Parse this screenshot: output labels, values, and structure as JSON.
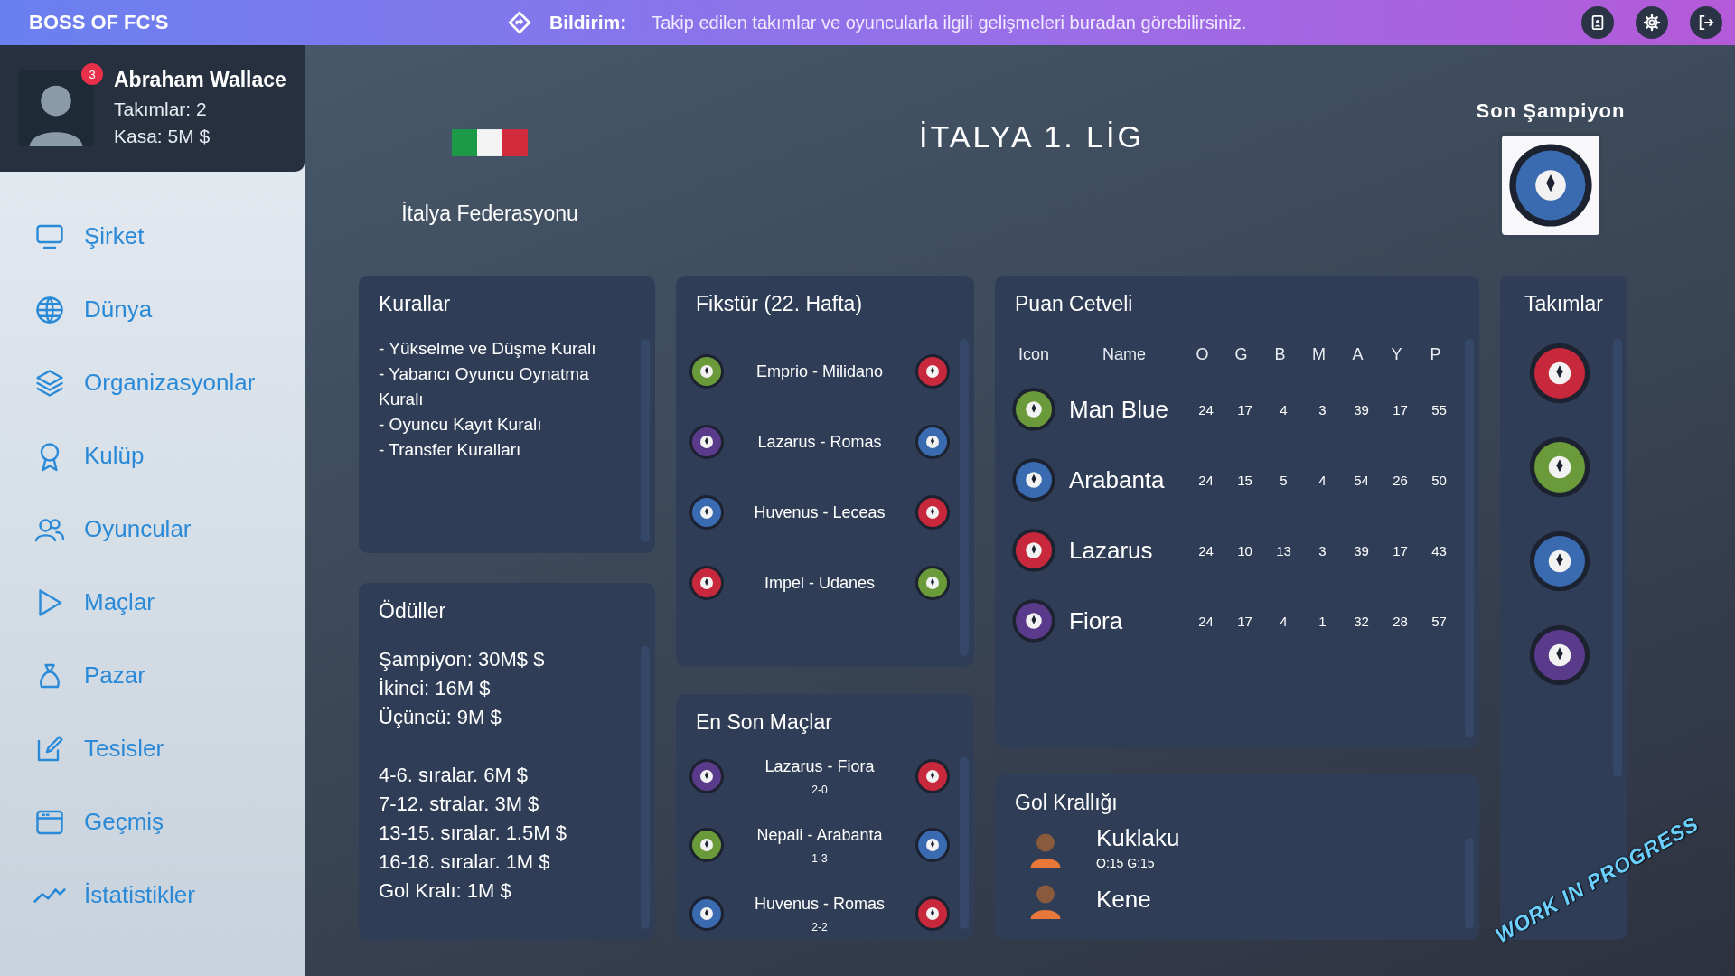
{
  "top_bar": {
    "app_title": "BOSS OF FC'S",
    "notice_label": "Bildirim:",
    "notice_text": "Takip edilen takımlar ve oyuncularla ilgili gelişmeleri buradan görebilirsiniz."
  },
  "profile": {
    "badge": "3",
    "name": "Abraham Wallace",
    "teams": "Takımlar: 2",
    "cash": "Kasa: 5M $"
  },
  "sidebar": {
    "items": [
      {
        "label": "Şirket",
        "kind": "monitor"
      },
      {
        "label": "Dünya",
        "kind": "globe"
      },
      {
        "label": "Organizasyonlar",
        "kind": "layers"
      },
      {
        "label": "Kulüp",
        "kind": "award"
      },
      {
        "label": "Oyuncular",
        "kind": "users"
      },
      {
        "label": "Maçlar",
        "kind": "play"
      },
      {
        "label": "Pazar",
        "kind": "bag"
      },
      {
        "label": "Tesisler",
        "kind": "edit"
      },
      {
        "label": "Geçmiş",
        "kind": "calendar"
      },
      {
        "label": "İstatistikler",
        "kind": "trend"
      }
    ]
  },
  "league": {
    "federation": "İtalya Federasyonu",
    "title": "İTALYA 1. LİG",
    "champion_label": "Son Şampiyon",
    "champion": {
      "color": "#3a6ab0"
    }
  },
  "rules": {
    "title": "Kurallar",
    "lines": [
      "- Yükselme ve Düşme Kuralı",
      "- Yabancı Oyuncu Oynatma Kuralı",
      "- Oyuncu Kayıt Kuralı",
      "- Transfer Kuralları"
    ]
  },
  "prizes": {
    "title": "Ödüller",
    "groups": [
      [
        "Şampiyon: 30M$ $",
        "İkinci: 16M $",
        "Üçüncü: 9M $"
      ],
      [
        "4-6. sıralar. 6M $",
        "7-12. stralar. 3M $",
        "13-15. sıralar. 1.5M $",
        "16-18. sıralar. 1M $",
        "Gol Kralı: 1M $"
      ]
    ]
  },
  "fixtures": {
    "title": "Fikstür (22. Hafta)",
    "matches": [
      {
        "home": {
          "color": "#6a9a3a"
        },
        "match": "Emprio - Milidano",
        "away": {
          "color": "#c8283c"
        }
      },
      {
        "home": {
          "color": "#5a3a8a"
        },
        "match": "Lazarus - Romas",
        "away": {
          "color": "#3a6ab0"
        }
      },
      {
        "home": {
          "color": "#3a6ab0"
        },
        "match": "Huvenus - Leceas",
        "away": {
          "color": "#c8283c"
        }
      },
      {
        "home": {
          "color": "#c8283c"
        },
        "match": "Impel - Udanes",
        "away": {
          "color": "#6a9a3a"
        }
      }
    ]
  },
  "recent": {
    "title": "En Son Maçlar",
    "matches": [
      {
        "home": {
          "color": "#5a3a8a"
        },
        "match": "Lazarus - Fiora",
        "score": "2-0",
        "away": {
          "color": "#c8283c"
        }
      },
      {
        "home": {
          "color": "#6a9a3a"
        },
        "match": "Nepali - Arabanta",
        "score": "1-3",
        "away": {
          "color": "#3a6ab0"
        }
      },
      {
        "home": {
          "color": "#3a6ab0"
        },
        "match": "Huvenus - Romas",
        "score": "2-2",
        "away": {
          "color": "#c8283c"
        }
      }
    ]
  },
  "standings": {
    "title": "Puan Cetveli",
    "columns": [
      "Icon",
      "Name",
      "O",
      "G",
      "B",
      "M",
      "A",
      "Y",
      "P"
    ],
    "rows": [
      {
        "color": "#6a9a3a",
        "cells": [
          "",
          "Man Blue",
          "24",
          "17",
          "4",
          "3",
          "39",
          "17",
          "55"
        ]
      },
      {
        "color": "#3a6ab0",
        "cells": [
          "",
          "Arabanta",
          "24",
          "15",
          "5",
          "4",
          "54",
          "26",
          "50"
        ]
      },
      {
        "color": "#c8283c",
        "cells": [
          "",
          "Lazarus",
          "24",
          "10",
          "13",
          "3",
          "39",
          "17",
          "43"
        ]
      },
      {
        "color": "#5a3a8a",
        "cells": [
          "",
          "Fiora",
          "24",
          "17",
          "4",
          "1",
          "32",
          "28",
          "57"
        ]
      }
    ]
  },
  "top_scorers": {
    "title": "Gol Krallığı",
    "players": [
      {
        "name": "Kuklaku",
        "stats": "O:15  G:15"
      },
      {
        "name": "Kene"
      }
    ]
  },
  "teams": {
    "title": "Takımlar",
    "items": [
      {
        "color": "#c8283c"
      },
      {
        "color": "#6a9a3a"
      },
      {
        "color": "#3a6ab0"
      },
      {
        "color": "#5a3a8a"
      }
    ]
  },
  "stamp": "WORK IN PROGRESS"
}
